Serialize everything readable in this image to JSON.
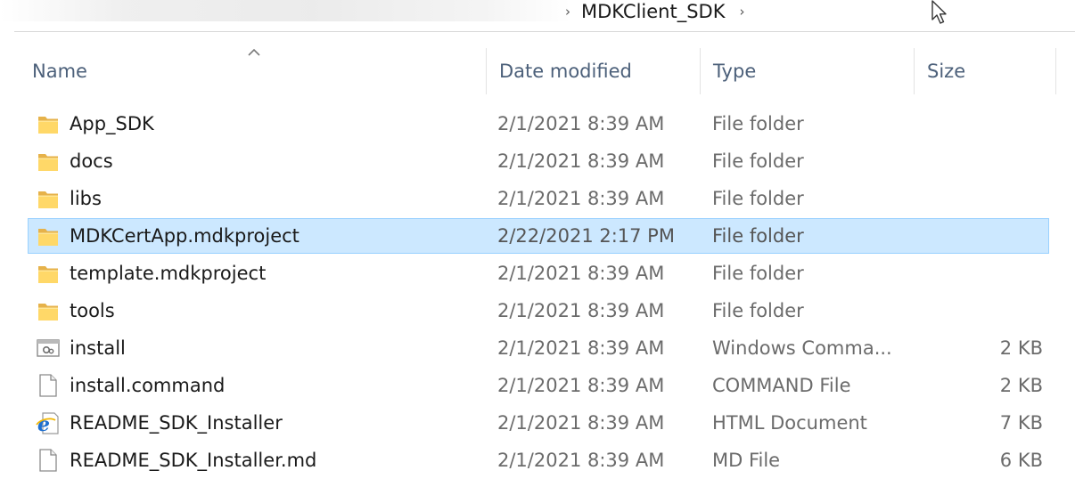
{
  "breadcrumb": {
    "current_folder": "MDKClient_SDK"
  },
  "columns": {
    "name": "Name",
    "date": "Date modified",
    "type": "Type",
    "size": "Size"
  },
  "sort": {
    "column": "name",
    "direction": "ascending"
  },
  "selection_color": "#cce8ff",
  "files": [
    {
      "name": "App_SDK",
      "date": "2/1/2021 8:39 AM",
      "type": "File folder",
      "size": "",
      "icon": "folder-icon",
      "selected": false
    },
    {
      "name": "docs",
      "date": "2/1/2021 8:39 AM",
      "type": "File folder",
      "size": "",
      "icon": "folder-icon",
      "selected": false
    },
    {
      "name": "libs",
      "date": "2/1/2021 8:39 AM",
      "type": "File folder",
      "size": "",
      "icon": "folder-icon",
      "selected": false
    },
    {
      "name": "MDKCertApp.mdkproject",
      "date": "2/22/2021 2:17 PM",
      "type": "File folder",
      "size": "",
      "icon": "folder-icon",
      "selected": true
    },
    {
      "name": "template.mdkproject",
      "date": "2/1/2021 8:39 AM",
      "type": "File folder",
      "size": "",
      "icon": "folder-icon",
      "selected": false
    },
    {
      "name": "tools",
      "date": "2/1/2021 8:39 AM",
      "type": "File folder",
      "size": "",
      "icon": "folder-icon",
      "selected": false
    },
    {
      "name": "install",
      "date": "2/1/2021 8:39 AM",
      "type": "Windows Comma...",
      "size": "2 KB",
      "icon": "batch-file-icon",
      "selected": false
    },
    {
      "name": "install.command",
      "date": "2/1/2021 8:39 AM",
      "type": "COMMAND File",
      "size": "2 KB",
      "icon": "blank-file-icon",
      "selected": false
    },
    {
      "name": "README_SDK_Installer",
      "date": "2/1/2021 8:39 AM",
      "type": "HTML Document",
      "size": "7 KB",
      "icon": "ie-html-icon",
      "selected": false
    },
    {
      "name": "README_SDK_Installer.md",
      "date": "2/1/2021 8:39 AM",
      "type": "MD File",
      "size": "6 KB",
      "icon": "blank-file-icon",
      "selected": false
    }
  ]
}
